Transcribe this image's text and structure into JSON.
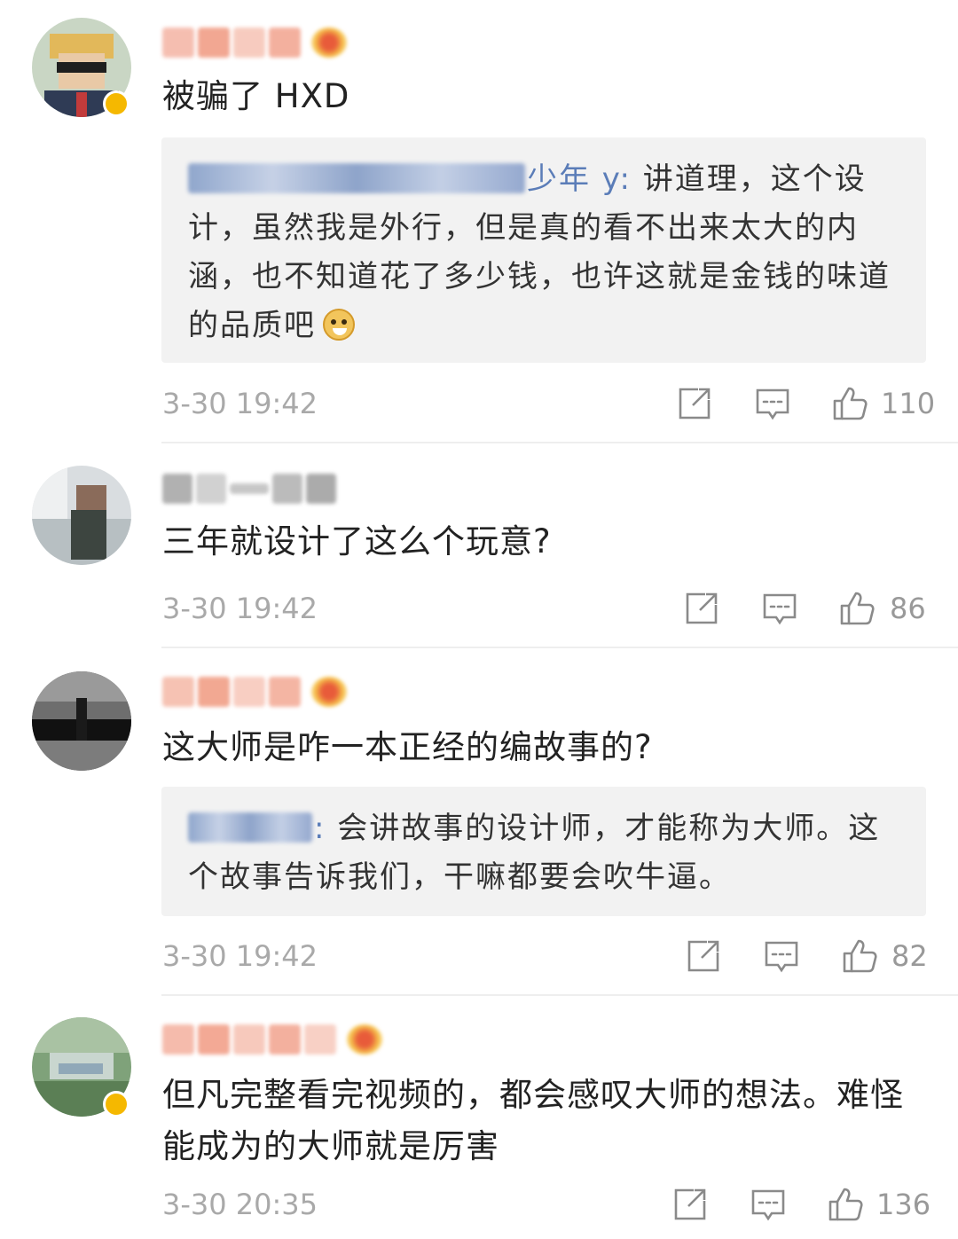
{
  "comments": [
    {
      "text": "被骗了 HXD",
      "has_crown": true,
      "reply": {
        "user_visible": "少年 y",
        "sep": ":",
        "text": " 讲道理，这个设计，虽然我是外行，但是真的看不出来太大的内涵，也不知道花了多少钱，也许这就是金钱的味道的品质吧",
        "emoji_icon": "doge-emoji-icon"
      },
      "time": "3-30 19:42",
      "likes": "110"
    },
    {
      "text": "三年就设计了这么个玩意?",
      "has_crown": false,
      "time": "3-30 19:42",
      "likes": "86"
    },
    {
      "text": "这大师是咋一本正经的编故事的?",
      "has_crown": true,
      "reply": {
        "user_visible": "",
        "sep": ":",
        "text": " 会讲故事的设计师，才能称为大师。这个故事告诉我们，干嘛都要会吹牛逼。"
      },
      "time": "3-30 19:42",
      "likes": "82"
    },
    {
      "text": "但凡完整看完视频的，都会感叹大师的想法。难怪能成为的大师就是厉害",
      "has_crown": true,
      "time": "3-30 20:35",
      "likes": "136"
    }
  ],
  "icons": {
    "share": "share-icon",
    "reply": "comment-icon",
    "like": "thumbs-up-icon",
    "verified": "verified-badge-icon",
    "crown": "crown-badge-icon"
  },
  "colors": {
    "username_blur": "#f2a38e",
    "reply_user": "#5b7db8",
    "quote_bg": "#f2f2f2",
    "meta_text": "#a9a9a9",
    "icon_stroke": "#8a8a8a",
    "verified_badge": "#f5b800"
  }
}
